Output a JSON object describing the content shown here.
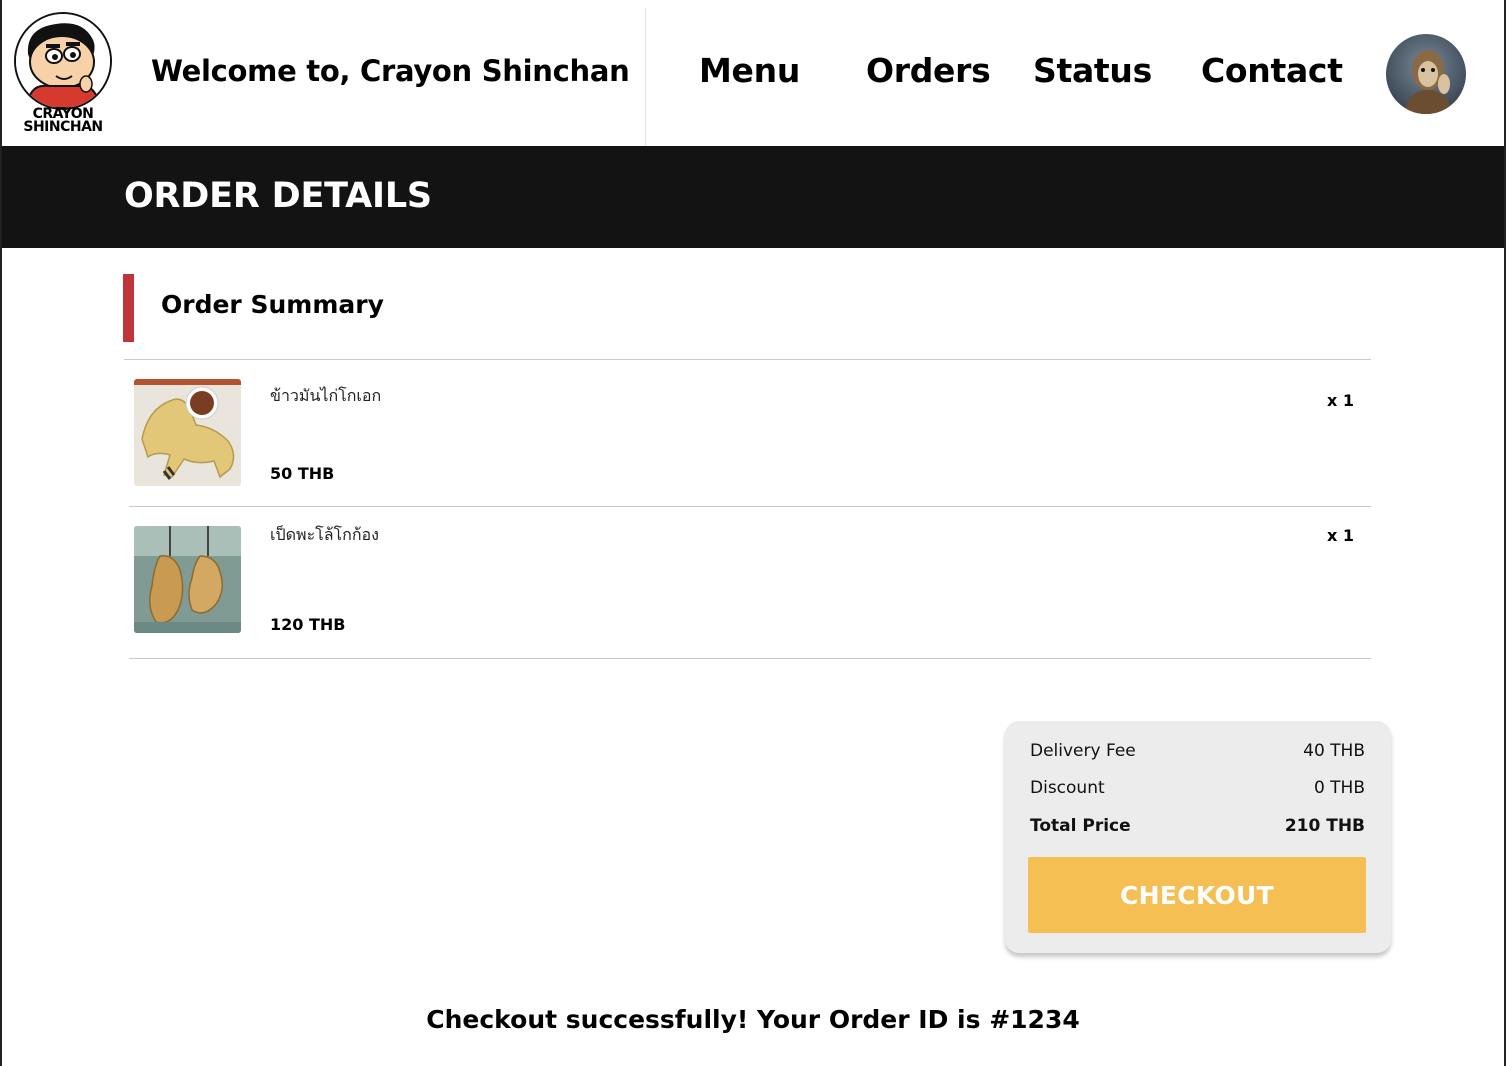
{
  "header": {
    "logo_text_line1": "CRAYON",
    "logo_text_line2": "SHINCHAN",
    "welcome": "Welcome to, Crayon Shinchan",
    "nav": [
      {
        "label": "Menu"
      },
      {
        "label": "Orders"
      },
      {
        "label": "Status"
      },
      {
        "label": "Contact"
      }
    ],
    "avatar_icon": "user-avatar-photo"
  },
  "banner": {
    "title": "ORDER DETAILS"
  },
  "summary": {
    "title": "Order Summary",
    "accent_color": "#c0353a",
    "items": [
      {
        "name": "ข้าวมันไก่โกเอก",
        "price": "50 THB",
        "qty": "x 1",
        "image_icon": "chicken-rice-photo"
      },
      {
        "name": "เป็ดพะโล้โกก้อง",
        "price": "120 THB",
        "qty": "x 1",
        "image_icon": "roast-duck-photo"
      }
    ]
  },
  "totals": {
    "delivery_fee_label": "Delivery Fee",
    "delivery_fee_value": "40 THB",
    "discount_label": "Discount",
    "discount_value": "0 THB",
    "total_label": "Total Price",
    "total_value": "210 THB",
    "checkout_label": "CHECKOUT",
    "checkout_color": "#f5bf54"
  },
  "message": "Checkout successfully! Your Order ID is #1234"
}
